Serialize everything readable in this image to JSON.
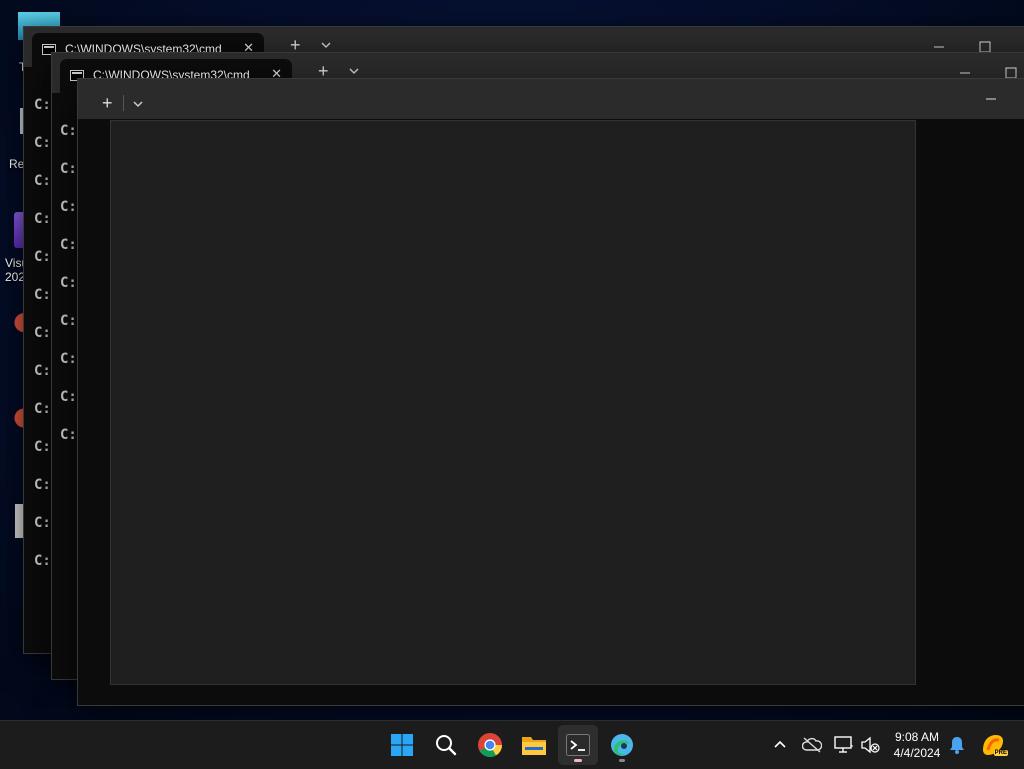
{
  "desktop": {
    "labels": [
      {
        "text": "T"
      },
      {
        "text": "Re"
      },
      {
        "text": "Visu"
      },
      {
        "text": "202"
      }
    ]
  },
  "windows": [
    {
      "title": "C:\\WINDOWS\\system32\\cmd",
      "close_glyph": "✕"
    },
    {
      "title": "C:\\WINDOWS\\system32\\cmd",
      "close_glyph": "✕"
    }
  ],
  "terminal": {
    "back_prompt": "C:",
    "mid_prompt": "C:\\Use",
    "back_line_count": 13,
    "mid_line_count": 9
  },
  "front_window": {
    "new_tab_glyph": "+"
  },
  "taskbar": {
    "apps": [
      "start-icon",
      "search-icon",
      "chrome-icon",
      "file-explorer-icon",
      "terminal-icon",
      "edge-beta-icon"
    ],
    "time": "9:08 AM",
    "date": "4/4/2024",
    "copilot_badge": "PRE"
  },
  "colors": {
    "terminal_bg": "#0c0c0c",
    "titlebar_bg": "#2b2b2b",
    "blank_pane_bg": "#1f1f1f",
    "taskbar_bg": "#1c1c1c",
    "accent_blue": "#0078d4"
  }
}
